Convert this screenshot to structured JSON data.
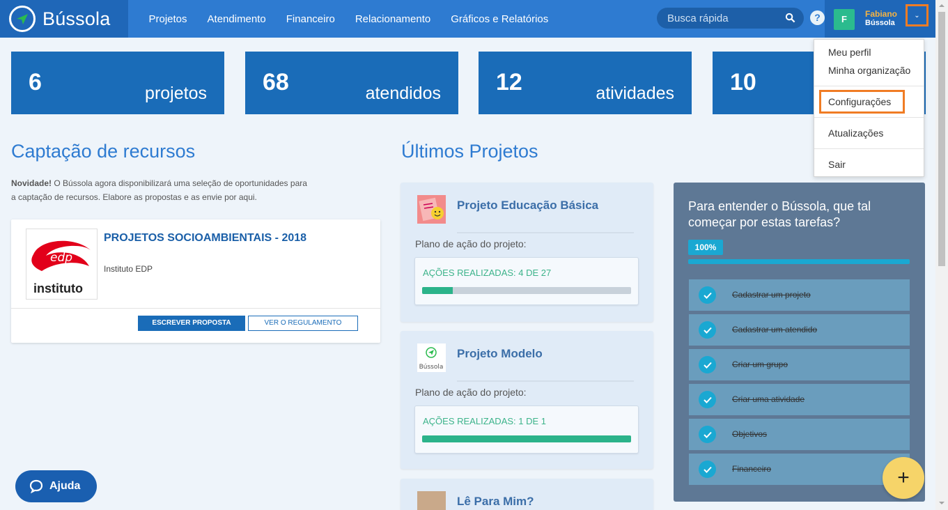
{
  "app": {
    "name": "Bússola"
  },
  "nav": [
    "Projetos",
    "Atendimento",
    "Financeiro",
    "Relacionamento",
    "Gráficos e Relatórios"
  ],
  "search": {
    "placeholder": "Busca rápida"
  },
  "user": {
    "initial": "F",
    "name": "Fabiano",
    "org": "Bússola"
  },
  "stats": [
    {
      "value": "6",
      "label": "projetos"
    },
    {
      "value": "68",
      "label": "atendidos"
    },
    {
      "value": "12",
      "label": "atividades"
    },
    {
      "value": "10",
      "label": ""
    }
  ],
  "captacao": {
    "title": "Captação de recursos",
    "novidade_bold": "Novidade!",
    "novidade_text": " O Bússola agora disponibilizará uma seleção de oportunidades para a captação de recursos. Elabore as propostas e as envie por aqui.",
    "card": {
      "logo_text": "instituto",
      "logo_brand": "edp",
      "title": "PROJETOS SOCIOAMBIENTAIS - 2018",
      "org": "Instituto EDP",
      "btn_write": "ESCREVER PROPOSTA",
      "btn_rules": "VER O REGULAMENTO"
    }
  },
  "projects": {
    "title": "Últimos Projetos",
    "items": [
      {
        "name": "Projeto Educação Básica",
        "plan": "Plano de ação do projeto:",
        "actions": "AÇÕES REALIZADAS: 4 DE 27",
        "progress": 0.148
      },
      {
        "name": "Projeto Modelo",
        "plan": "Plano de ação do projeto:",
        "actions": "AÇÕES REALIZADAS: 1 DE 1",
        "progress": 1.0,
        "logo_caption": "Bússola"
      },
      {
        "name": "Lê Para Mim?"
      }
    ]
  },
  "tasks": {
    "title": "Para entender o Bússola, que tal começar por estas tarefas?",
    "percent": "100%",
    "progress": 1.0,
    "items": [
      "Cadastrar um projeto",
      "Cadastrar um atendido",
      "Criar um grupo",
      "Criar uma atividade",
      "Objetivos",
      "Financeiro"
    ]
  },
  "menu": {
    "items": [
      "Meu perfil",
      "Minha organização",
      "Configurações",
      "Atualizações",
      "Sair"
    ]
  },
  "help": {
    "label": "Ajuda"
  },
  "fab": {
    "label": "+"
  },
  "colors": {
    "primary": "#2e7bd1",
    "dark": "#1a6cb8",
    "accent": "#f07c24",
    "success": "#2bb38a"
  }
}
